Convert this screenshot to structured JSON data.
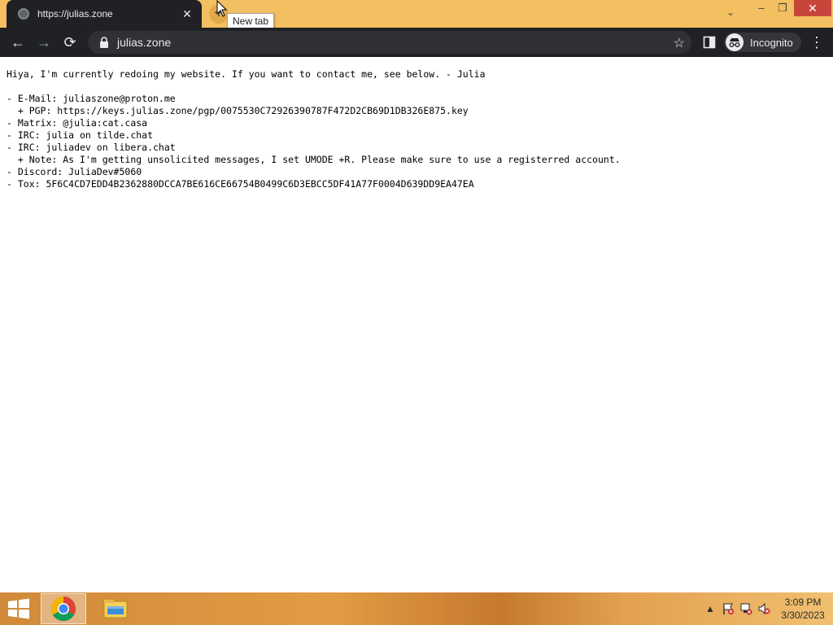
{
  "browser": {
    "tab": {
      "title": "https://julias.zone",
      "close": "✕"
    },
    "new_tab": {
      "label": "+",
      "tooltip": "New tab"
    },
    "tab_search": "⌄",
    "window": {
      "minimize": "–",
      "maximize": "❐",
      "close": "✕"
    },
    "toolbar": {
      "back": "←",
      "forward": "→",
      "reload": "⟳",
      "star": "☆",
      "menu": "⋮"
    },
    "address": {
      "url": "julias.zone"
    },
    "incognito_label": "Incognito"
  },
  "page": {
    "lines": [
      "Hiya, I'm currently redoing my website. If you want to contact me, see below. - Julia",
      "",
      "- E-Mail: juliaszone@proton.me",
      "  + PGP: https://keys.julias.zone/pgp/0075530C72926390787F472D2CB69D1DB326E875.key",
      "- Matrix: @julia:cat.casa",
      "- IRC: julia on tilde.chat",
      "- IRC: juliadev on libera.chat",
      "  + Note: As I'm getting unsolicited messages, I set UMODE +R. Please make sure to use a registerred account.",
      "- Discord: JuliaDev#5060",
      "- Tox: 5F6C4CD7EDD4B2362880DCCA7BE616CE66754B0499C6D3EBCC5DF41A77F0004D639DD9EA47EA"
    ]
  },
  "taskbar": {
    "clock": {
      "time": "3:09 PM",
      "date": "3/30/2023"
    },
    "tray": {
      "chevron": "▲"
    }
  },
  "colors": {
    "titlebar": "#f2c060",
    "tab_active": "#202124",
    "toolbar": "#202124",
    "omnibox": "#303134",
    "close_button": "#c7463c"
  }
}
